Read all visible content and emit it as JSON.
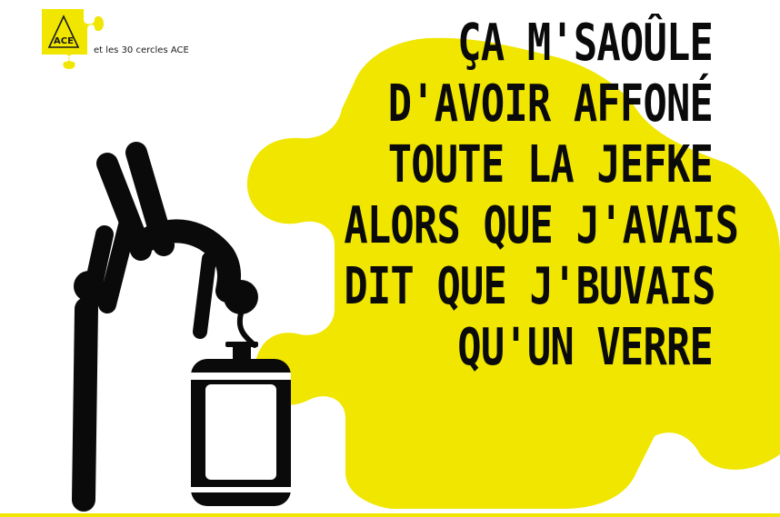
{
  "brand": {
    "logo_text": "ACE",
    "circles_text": "et les 30 cercles ACE"
  },
  "headline": {
    "lines": [
      "ÇA M'SAOÛLE",
      "D'AVOIR AFFONÉ",
      "TOUTE LA JEFKE",
      "ALORS QUE J'AVAIS",
      "DIT QUE J'BUVAIS",
      "QU'UN VERRE"
    ]
  },
  "colors": {
    "accent": "#f0e600",
    "ink": "#0a0a0a",
    "background": "#ffffff"
  },
  "icons": {
    "logo": "ace-puzzle-logo-icon",
    "figure": "drinking-person-pictogram-icon",
    "keg": "beer-keg-icon",
    "background": "puzzle-piece-shape"
  }
}
